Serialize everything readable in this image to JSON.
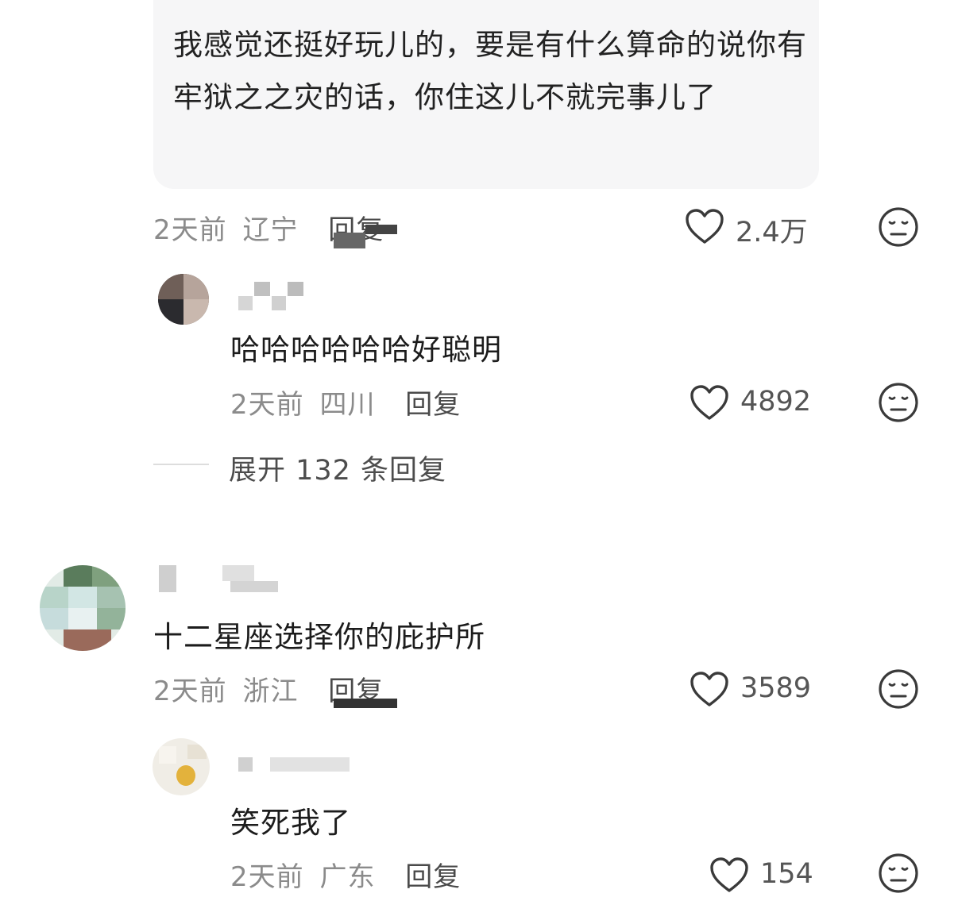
{
  "quoted_comment": {
    "text": "我感觉还挺好玩儿的，要是有什么算命的说你有牢狱之之灾的话，你住这儿不就完事儿了",
    "meta": {
      "time": "2天前",
      "location": "辽宁",
      "reply_label": "回复"
    },
    "likes": "2.4万"
  },
  "reply_1": {
    "text": "哈哈哈哈哈哈好聪明",
    "meta": {
      "time": "2天前",
      "location": "四川",
      "reply_label": "回复"
    },
    "likes": "4892"
  },
  "expand_replies": {
    "label": "展开 132 条回复"
  },
  "comment_2": {
    "text": "十二星座选择你的庇护所",
    "meta": {
      "time": "2天前",
      "location": "浙江",
      "reply_label": "回复"
    },
    "likes": "3589"
  },
  "reply_2": {
    "text": "笑死我了",
    "meta": {
      "time": "2天前",
      "location": "广东",
      "reply_label": "回复"
    },
    "likes": "154"
  },
  "icons": {
    "like": "heart-icon",
    "dislike": "dislike-face-icon"
  },
  "colors": {
    "bubble_bg": "#f6f6f7",
    "meta_text": "#8b8b8b",
    "icon_stroke": "#3a3a3a"
  }
}
